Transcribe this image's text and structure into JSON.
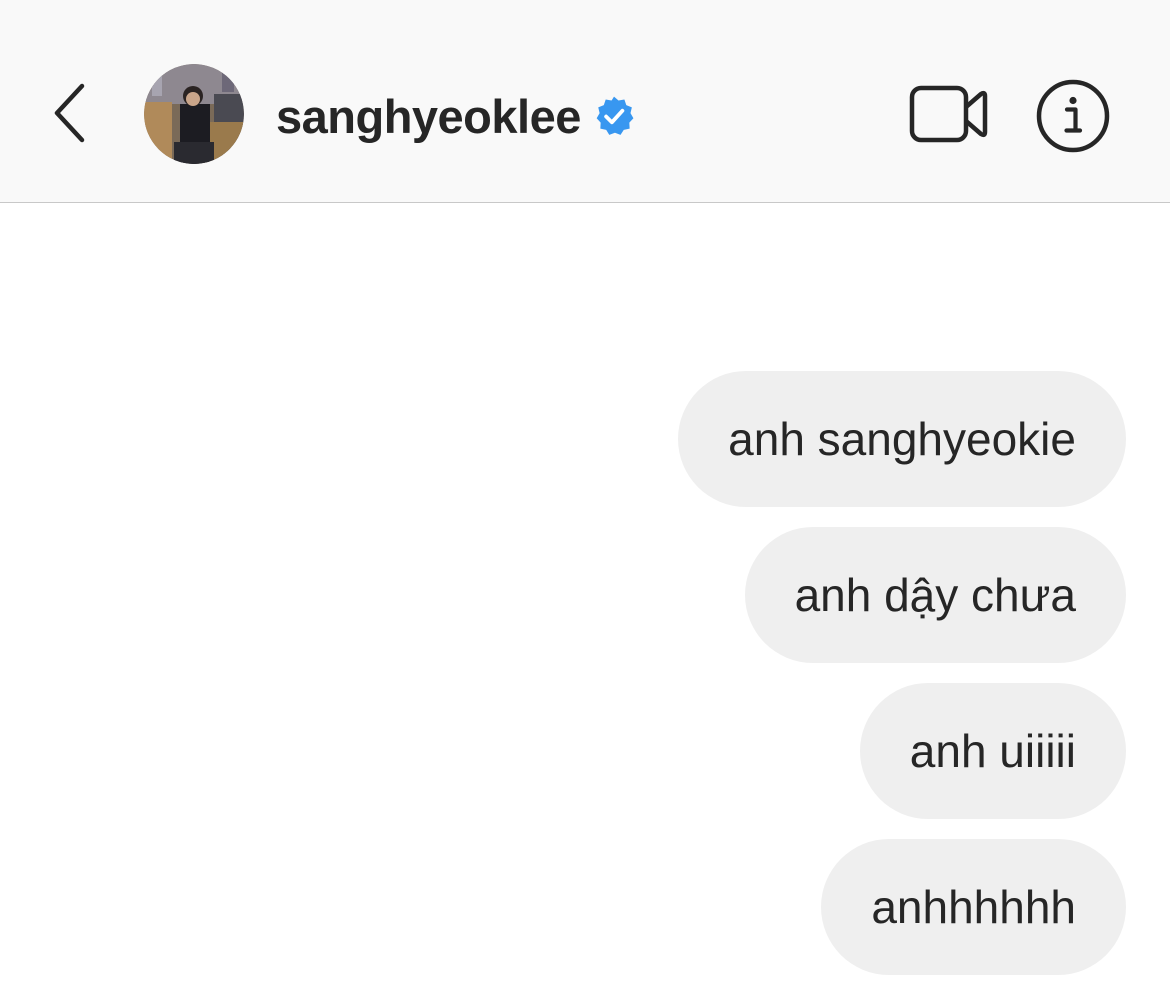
{
  "header": {
    "username": "sanghyeoklee",
    "verified": true,
    "verified_color": "#3897f0",
    "icons": {
      "back": "chevron-left-icon",
      "video": "video-camera-icon",
      "info": "info-circle-icon"
    }
  },
  "messages": [
    {
      "text": "anh sanghyeokie",
      "sender": "me"
    },
    {
      "text": "anh dậy chưa",
      "sender": "me"
    },
    {
      "text": "anh uiiiii",
      "sender": "me"
    },
    {
      "text": "anhhhhhh",
      "sender": "me"
    }
  ],
  "colors": {
    "bubble_bg": "#efefef",
    "header_bg": "#f9f9f9",
    "text": "#262626"
  }
}
